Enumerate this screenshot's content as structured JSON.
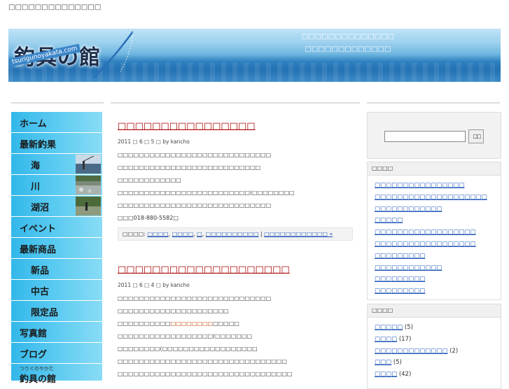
{
  "header": {
    "tagline": "□□□□□□□□□□□□□□",
    "logo_text": "釣具の館",
    "logo_url": "tsurigunoyakata.com",
    "banner_line1": "□□□□□□□□□□□□□□",
    "banner_line2": "□□□□□□□□□□□□□"
  },
  "nav": {
    "items": [
      {
        "label": "ホーム",
        "level": "top"
      },
      {
        "label": "最新釣果",
        "level": "top"
      },
      {
        "label": "海",
        "level": "sub",
        "thumb": "sea"
      },
      {
        "label": "川",
        "level": "sub",
        "thumb": "river"
      },
      {
        "label": "湖沼",
        "level": "sub",
        "thumb": "lake"
      },
      {
        "label": "イベント",
        "level": "top"
      },
      {
        "label": "最新商品",
        "level": "top"
      },
      {
        "label": "新品",
        "level": "sub"
      },
      {
        "label": "中古",
        "level": "sub"
      },
      {
        "label": "限定品",
        "level": "sub"
      },
      {
        "label": "写真館",
        "level": "top"
      },
      {
        "label": "ブログ",
        "level": "top"
      }
    ],
    "footer_small": "つりぐのやかた",
    "footer_big": "釣具の館"
  },
  "posts": [
    {
      "title": "□□□□□□□□□□□□□□□□",
      "meta": "2011 □ 6 □ 5 □ by kancho",
      "lines": [
        "□□□□□□□□□□□□□□□□□□□□□□□□□□□□□",
        "□□□□□□□□□□□□□□□□□□□□□□□□□□□",
        "□□□□□□□□□□□□",
        "□□□□□□□□□□□□□□□□□□□□□□□□□(□□□□□□□□",
        "□□□□□□□□□□□□□□□□□□□□□□□□□□□□□",
        "□□□018-880-5582□"
      ],
      "tags_label": "□□□□:",
      "tags": [
        "□□□□",
        "□□□□",
        "□",
        "□□□□□□□□□□"
      ],
      "comments": "□□□□□□□□□□□□ »"
    },
    {
      "title": "□□□□□□□□□□□□□□□□□□□□",
      "meta": "2011 □ 6 □ 4 □ by kancho",
      "line1": "□□□□□□□□□□□□□□□□□□□□□□□□□□□□□",
      "line2": "□□□□□□□□□□□□□□□□□□□□□",
      "line3_pre": "□□□□□□□□□□",
      "line3_hl": "□□□□□□□□",
      "line3_post": "□□□□□",
      "line4": "□□□□□□□□□□□□□□□□□□(□□□□□□□",
      "line5": "□□□□□□□□(□□□□□□□□□□□□□□□□□□",
      "line6": "□□□□□□□□□□□□□□□□□□□□□□□□□□□□□□□□",
      "line7": "□□□□□□□□□□□□□□□□□□□□□□□□□□□□□□□□□"
    }
  ],
  "search": {
    "button": "□□",
    "placeholder": ""
  },
  "recent": {
    "title": "□□□□",
    "items": [
      "□□□□□□□□□□□□□□□□",
      "□□□□□□□□□□□□□□□□□□□□",
      "□□□□□□□□□□□□",
      "□□□□□",
      "□□□□□□□□□□□□□□□□□□",
      "□□□□□□□□□□□□□□□□□□",
      "□□□□□□□□□",
      "□□□□□□□□□□□□",
      "□□□□□□□□□",
      "□□□□□□□□□"
    ]
  },
  "categories": {
    "title": "□□□□",
    "items": [
      {
        "name": "□□□□□",
        "count": "(5)"
      },
      {
        "name": "□□□□",
        "count": "(17)"
      },
      {
        "name": "□□□□□□□□□□□□□",
        "count": "(2)"
      },
      {
        "name": "□□□",
        "count": "(5)"
      },
      {
        "name": "□□□□",
        "count": "(42)"
      }
    ]
  }
}
